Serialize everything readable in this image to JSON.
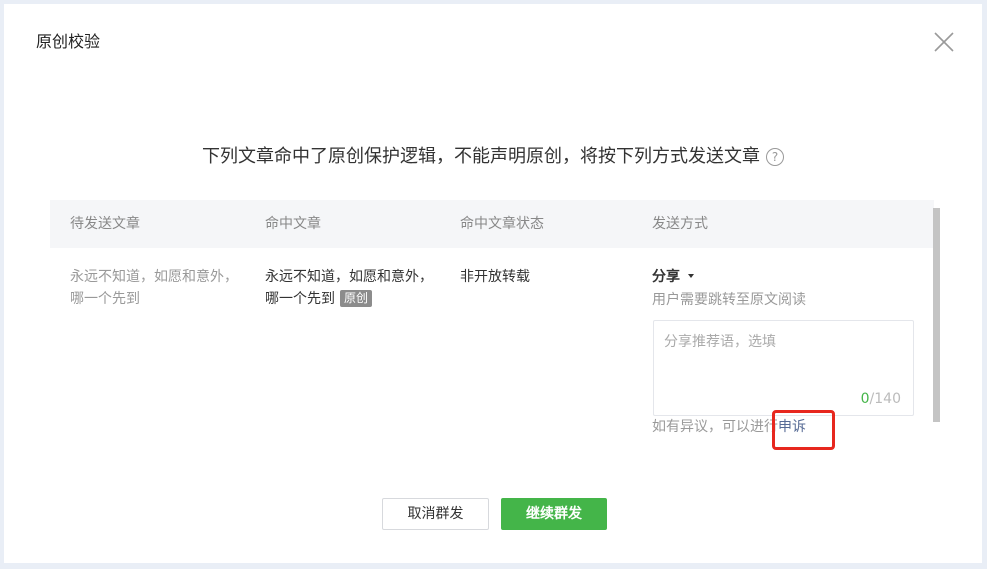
{
  "dialog": {
    "title": "原创校验",
    "notice": "下列文章命中了原创保护逻辑，不能声明原创，将按下列方式发送文章",
    "help_icon": "?"
  },
  "table": {
    "headers": [
      "待发送文章",
      "命中文章",
      "命中文章状态",
      "发送方式"
    ],
    "row": {
      "pending_article": [
        "永远不知道，如愿和意外，",
        "哪一个先到"
      ],
      "hit_article": [
        "永远不知道，如愿和意外，",
        "哪一个先到"
      ],
      "hit_badge": "原创",
      "hit_status": "非开放转载",
      "send_method": "分享",
      "send_method_desc": "用户需要跳转至原文阅读",
      "share_placeholder": "分享推荐语，选填",
      "char_count": "0",
      "char_limit": "/140",
      "appeal_text": "如有异议，可以进行",
      "appeal_link": "申诉"
    }
  },
  "buttons": {
    "cancel": "取消群发",
    "continue": "继续群发"
  },
  "colors": {
    "primary_green": "#44b549",
    "link_blue": "#576b95",
    "highlight_red": "#e7271e"
  },
  "icons": {
    "close": "close-icon",
    "help": "help-icon",
    "dropdown": "chevron-down-icon"
  }
}
